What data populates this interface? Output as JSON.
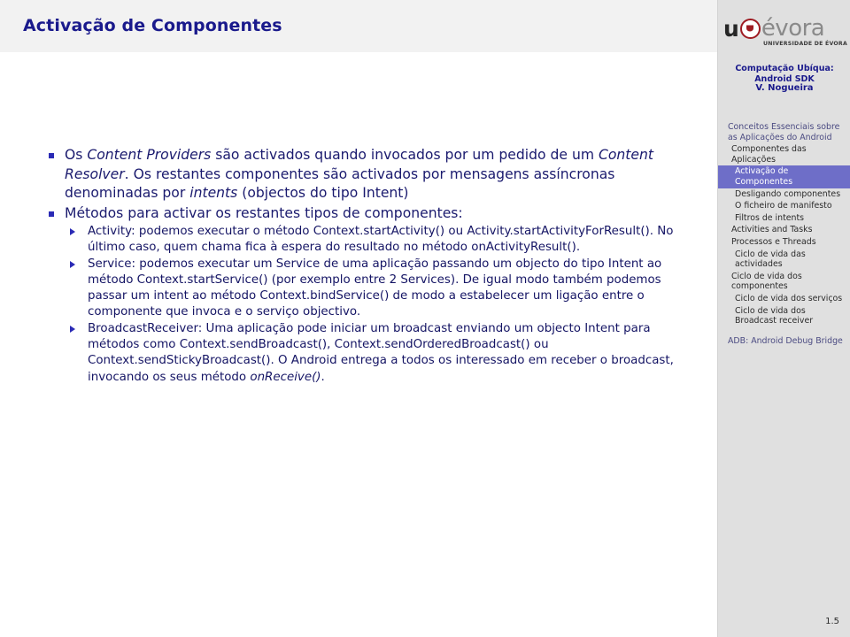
{
  "header": {
    "title": "Activação de Componentes",
    "title_color": "#1a1a8c",
    "band_color": "#f2f2f2"
  },
  "logo": {
    "u_text": "u",
    "seal": "university-seal",
    "evora_text": "évora",
    "caption": "UNIVERSIDADE DE ÉVORA"
  },
  "rail": {
    "background_color": "#e0e0e0",
    "meta": {
      "course": "Computação Ubíqua:",
      "sdk": "Android SDK",
      "author": "V. Nogueira"
    },
    "accent_color": "#6e6ec8",
    "nav": [
      {
        "label": "Conceitos Essenciais sobre as Aplicações do Android",
        "level": 1,
        "active": false
      },
      {
        "label": "Componentes das Aplicações",
        "level": 2,
        "active": false
      },
      {
        "label": "Activação de Componentes",
        "level": 3,
        "active": true
      },
      {
        "label": "Desligando componentes",
        "level": 3,
        "active": false
      },
      {
        "label": "O ficheiro de manifesto",
        "level": 3,
        "active": false
      },
      {
        "label": "Filtros de intents",
        "level": 3,
        "active": false
      },
      {
        "label": "Activities and Tasks",
        "level": 2,
        "active": false
      },
      {
        "label": "Processos e Threads",
        "level": 2,
        "active": false
      },
      {
        "label": "Ciclo de vida das actividades",
        "level": 3,
        "active": false
      },
      {
        "label": "Ciclo de vida dos componentes",
        "level": 2,
        "active": false
      },
      {
        "label": "Ciclo de vida dos serviços",
        "level": 3,
        "active": false
      },
      {
        "label": "Ciclo de vida dos Broadcast receiver",
        "level": 3,
        "active": false
      }
    ],
    "nav_footer": [
      {
        "label": "ADB: Android Debug Bridge",
        "level": 1,
        "active": false
      }
    ]
  },
  "content": {
    "bullets": [
      {
        "segments": [
          {
            "text": "Os ",
            "italic": false
          },
          {
            "text": "Content Providers",
            "italic": true
          },
          {
            "text": " são activados quando invocados por um pedido de um ",
            "italic": false
          },
          {
            "text": "Content Resolver",
            "italic": true
          },
          {
            "text": ". Os restantes componentes são activados por mensagens assíncronas denominadas por ",
            "italic": false
          },
          {
            "text": "intents",
            "italic": true
          },
          {
            "text": " (objectos do tipo Intent)",
            "italic": false
          }
        ],
        "sub": []
      },
      {
        "segments": [
          {
            "text": "Métodos para activar os restantes tipos de componentes:",
            "italic": false
          }
        ],
        "sub": [
          {
            "segments": [
              {
                "text": "Activity: podemos executar o método Context.startActivity() ou Activity.startActivityForResult(). No último caso, quem chama fica à espera do resultado no método onActivityResult().",
                "italic": false
              }
            ]
          },
          {
            "segments": [
              {
                "text": "Service: podemos executar um Service de uma aplicação passando um objecto do tipo Intent ao método Context.startService() (por exemplo entre 2 Services). De igual modo também podemos passar um intent ao método Context.bindService() de modo a estabelecer um ligação entre o componente que invoca e o serviço objectivo.",
                "italic": false
              }
            ]
          },
          {
            "segments": [
              {
                "text": "BroadcastReceiver: Uma aplicação pode iniciar um broadcast enviando um objecto Intent para métodos como Context.sendBroadcast(), Context.sendOrderedBroadcast() ou Context.sendStickyBroadcast(). O Android entrega a todos os interessado em receber o broadcast, invocando os seus método ",
                "italic": false
              },
              {
                "text": "onReceive()",
                "italic": true
              },
              {
                "text": ".",
                "italic": false
              }
            ]
          }
        ]
      }
    ]
  },
  "footer": {
    "page_number": "1.5"
  }
}
